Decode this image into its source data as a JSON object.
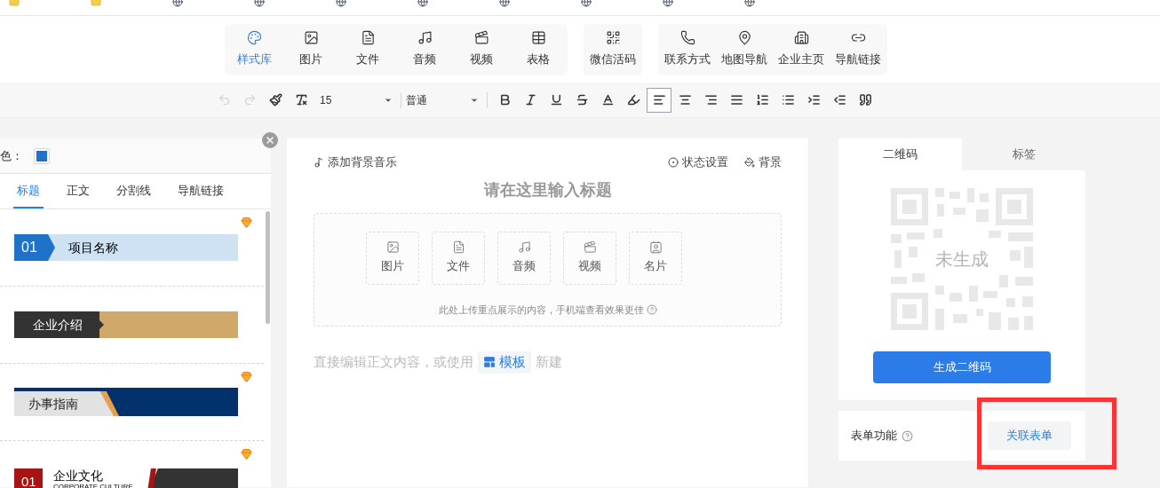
{
  "insert_toolbar": {
    "groups": [
      {
        "items": [
          {
            "label": "样式库",
            "selected": true
          },
          {
            "label": "图片",
            "selected": false
          },
          {
            "label": "文件",
            "selected": false
          },
          {
            "label": "音频",
            "selected": false
          },
          {
            "label": "视频",
            "selected": false
          },
          {
            "label": "表格",
            "selected": false
          }
        ]
      },
      {
        "items": [
          {
            "label": "微信活码",
            "selected": false
          }
        ]
      },
      {
        "items": [
          {
            "label": "联系方式",
            "selected": false
          },
          {
            "label": "地图导航",
            "selected": false
          },
          {
            "label": "企业主页",
            "selected": false
          },
          {
            "label": "导航链接",
            "selected": false
          }
        ]
      }
    ]
  },
  "format_toolbar": {
    "font_size": "15",
    "paragraph_style": "普通",
    "align_left_active": true
  },
  "style_panel": {
    "color_label": "色：",
    "color": "#1e73c8",
    "tabs": [
      {
        "label": "标题",
        "selected": true
      },
      {
        "label": "正文",
        "selected": false
      },
      {
        "label": "分割线",
        "selected": false
      },
      {
        "label": "导航链接",
        "selected": false
      }
    ],
    "templates": [
      {
        "kind": "numbered",
        "number": "01",
        "title": "项目名称",
        "premium": true
      },
      {
        "kind": "dark-gold",
        "title": "企业介绍",
        "premium": false
      },
      {
        "kind": "navy-slant",
        "title": "办事指南",
        "premium": true
      },
      {
        "kind": "red-dark",
        "number": "01",
        "title": "企业文化",
        "subtitle": "CORPORATE CULTURE",
        "premium": true
      }
    ]
  },
  "editor": {
    "music": "添加背景音乐",
    "status_settings": "状态设置",
    "background": "背景",
    "title_placeholder": "请在这里输入标题",
    "upload_items": [
      {
        "label": "图片"
      },
      {
        "label": "文件"
      },
      {
        "label": "音频"
      },
      {
        "label": "视频"
      },
      {
        "label": "名片"
      }
    ],
    "upload_hint": "此处上传重点展示的内容，手机端查看效果更佳",
    "body_prefix": "直接编辑正文内容，或使用",
    "template_button": "模板",
    "body_suffix": "新建"
  },
  "side_panel": {
    "tabs": [
      {
        "label": "二维码",
        "selected": true
      },
      {
        "label": "标签",
        "selected": false
      }
    ],
    "qr_status": "未生成",
    "generate_button": "生成二维码",
    "form_label": "表单功能",
    "link_form_button": "关联表单"
  },
  "highlight_box": {
    "color": "#ff3333"
  }
}
